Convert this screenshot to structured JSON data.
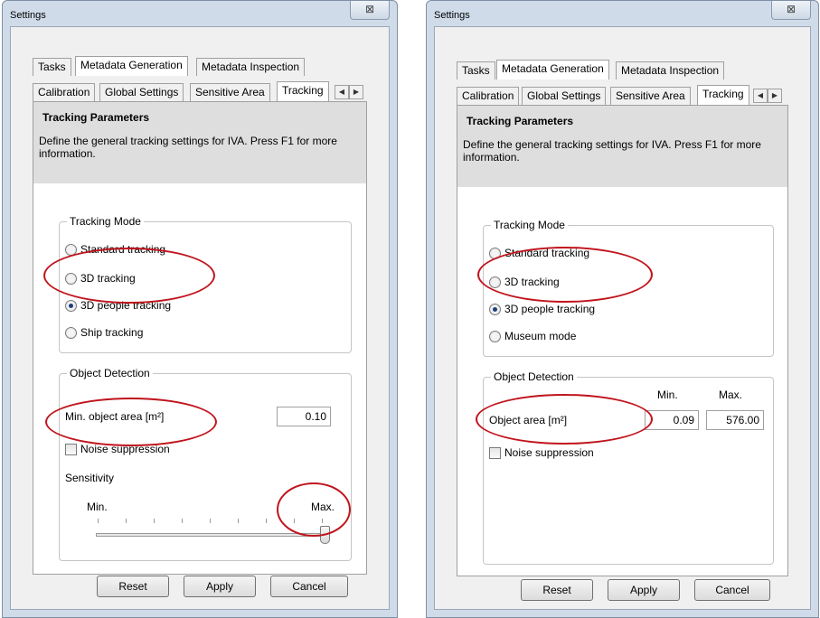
{
  "left": {
    "window_title": "Settings",
    "close_glyph": "⊠",
    "tabs_top": [
      "Tasks",
      "Metadata Generation",
      "Metadata Inspection"
    ],
    "tabs_sub": [
      "Calibration",
      "Global Settings",
      "Sensitive Area",
      "Tracking"
    ],
    "header_title": "Tracking Parameters",
    "header_desc": "Define the general tracking settings for IVA. Press F1 for more information.",
    "tracking_mode_label": "Tracking Mode",
    "modes": [
      "Standard tracking",
      "3D tracking",
      "3D people tracking",
      "Ship tracking"
    ],
    "selected_mode": "3D people tracking",
    "object_detection_label": "Object Detection",
    "min_area_label": "Min. object area [m²]",
    "min_area_value": "0.10",
    "noise_label": "Noise suppression",
    "sensitivity_label": "Sensitivity",
    "slider_min": "Min.",
    "slider_max": "Max.",
    "sensitivity_level": 1.0,
    "buttons": [
      "Reset",
      "Apply",
      "Cancel"
    ]
  },
  "right": {
    "window_title": "Settings",
    "close_glyph": "⊠",
    "tabs_top": [
      "Tasks",
      "Metadata Generation",
      "Metadata Inspection"
    ],
    "tabs_sub": [
      "Calibration",
      "Global Settings",
      "Sensitive Area",
      "Tracking"
    ],
    "header_title": "Tracking Parameters",
    "header_desc": "Define the general tracking settings for IVA. Press F1 for more information.",
    "tracking_mode_label": "Tracking Mode",
    "modes": [
      "Standard tracking",
      "3D tracking",
      "3D people tracking",
      "Museum mode"
    ],
    "selected_mode": "3D people tracking",
    "object_detection_label": "Object Detection",
    "col_min": "Min.",
    "col_max": "Max.",
    "area_label": "Object area [m²]",
    "area_min_value": "0.09",
    "area_max_value": "576.00",
    "noise_label": "Noise suppression",
    "buttons": [
      "Reset",
      "Apply",
      "Cancel"
    ]
  },
  "colors": {
    "annotation": "#c0141c",
    "window_frame": "#cfdbe9"
  }
}
